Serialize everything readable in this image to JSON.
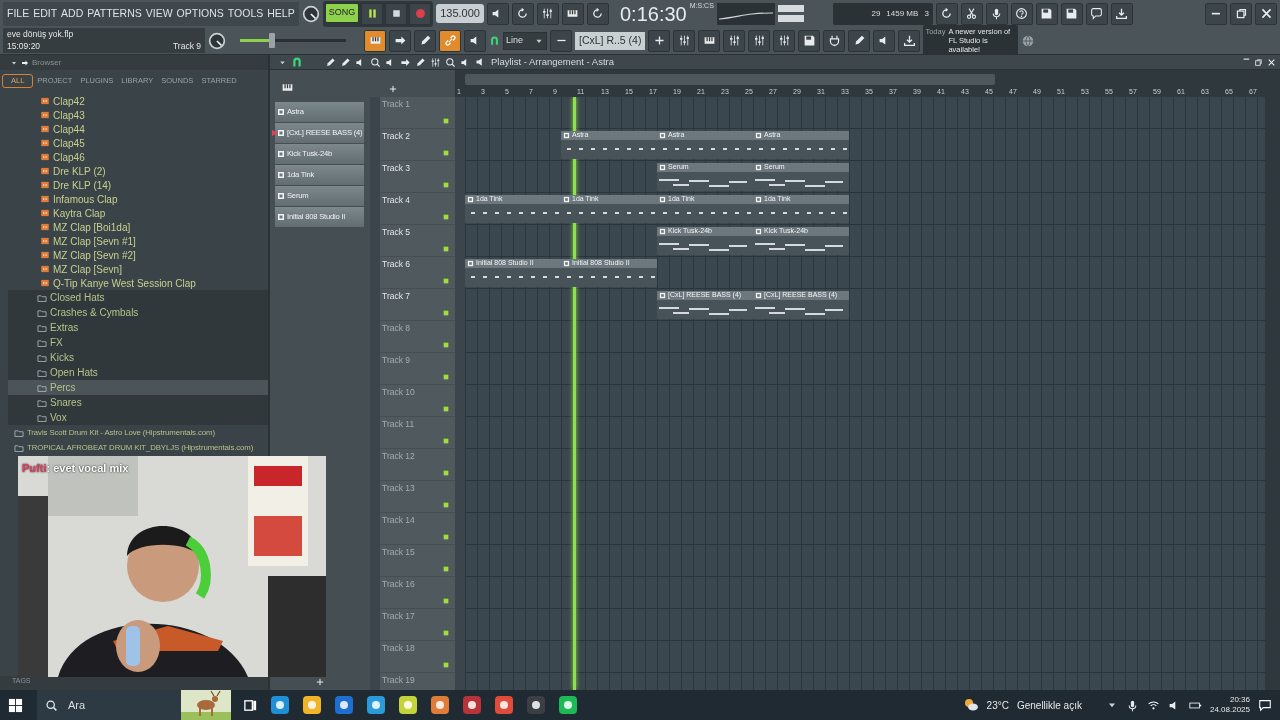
{
  "menu": [
    "FILE",
    "EDIT",
    "ADD",
    "PATTERNS",
    "VIEW",
    "OPTIONS",
    "TOOLS",
    "HELP"
  ],
  "transport": {
    "mode": {
      "label": "SONG",
      "on": true
    },
    "tempo": "135.000",
    "time": "0:16:30",
    "time_unit": "M:S:CS"
  },
  "monitor": {
    "cpu": "29",
    "memory": "1459 MB",
    "polyphony": "3"
  },
  "project": {
    "file": "eve dönüş yok.flp",
    "time": "15:09:20",
    "hint": "Track 9"
  },
  "master_volume": {
    "level": 0.3
  },
  "snap": "Line",
  "pattern": "[CxL] R..5 (4)",
  "news": {
    "label": "Today",
    "text": "A newer version of FL Studio is available!"
  },
  "browser": {
    "title": "Browser",
    "tabs": [
      {
        "label": "ALL",
        "selected": true
      },
      {
        "label": "PROJECT",
        "selected": false
      },
      {
        "label": "PLUGINS",
        "selected": false
      },
      {
        "label": "LIBRARY",
        "selected": false
      },
      {
        "label": "SOUNDS",
        "selected": false
      },
      {
        "label": "STARRED",
        "selected": false
      }
    ],
    "items": [
      {
        "kind": "file",
        "label": "Clap42",
        "selected": false
      },
      {
        "kind": "file",
        "label": "Clap43",
        "selected": false
      },
      {
        "kind": "file",
        "label": "Clap44",
        "selected": false
      },
      {
        "kind": "file",
        "label": "Clap45",
        "selected": false
      },
      {
        "kind": "file",
        "label": "Clap46",
        "selected": false
      },
      {
        "kind": "file",
        "label": "Dre KLP (2)",
        "selected": false
      },
      {
        "kind": "file",
        "label": "Dre KLP (14)",
        "selected": false
      },
      {
        "kind": "file",
        "label": "Infamous Clap",
        "selected": false
      },
      {
        "kind": "file",
        "label": "Kaytra Clap",
        "selected": false
      },
      {
        "kind": "file",
        "label": "MZ Clap [Boi1da]",
        "selected": false
      },
      {
        "kind": "file",
        "label": "MZ Clap [Sevn #1]",
        "selected": false
      },
      {
        "kind": "file",
        "label": "MZ Clap [Sevn #2]",
        "selected": false
      },
      {
        "kind": "file",
        "label": "MZ Clap [Sevn]",
        "selected": false
      },
      {
        "kind": "file",
        "label": "Q-Tip Kanye West Session Clap",
        "selected": false
      },
      {
        "kind": "folder",
        "label": "Closed Hats",
        "selected": false
      },
      {
        "kind": "folder",
        "label": "Crashes & Cymbals",
        "selected": false
      },
      {
        "kind": "folder",
        "label": "Extras",
        "selected": false
      },
      {
        "kind": "folder",
        "label": "FX",
        "selected": false
      },
      {
        "kind": "folder",
        "label": "Kicks",
        "selected": false
      },
      {
        "kind": "folder",
        "label": "Open Hats",
        "selected": false
      },
      {
        "kind": "folder",
        "label": "Percs",
        "selected": true
      },
      {
        "kind": "folder",
        "label": "Snares",
        "selected": false
      },
      {
        "kind": "folder",
        "label": "Vox",
        "selected": false
      },
      {
        "kind": "kit",
        "label": "Travis Scott Drum Kit - Astro Love (Hipstrumentals.com)",
        "selected": false
      },
      {
        "kind": "kit",
        "label": "TROPICAL AFROBEAT DRUM KIT_DBYLJS (Hipstrumentals.com)",
        "selected": false
      }
    ],
    "footer": "TAGS"
  },
  "chat": {
    "user": "Pufti",
    "message": ": evet vocal mix"
  },
  "patterns": [
    {
      "label": "Astra",
      "current": false
    },
    {
      "label": "[CxL] REESE BASS (4)",
      "current": true
    },
    {
      "label": "Kick Tusk-24b",
      "current": false
    },
    {
      "label": "1da Tink",
      "current": false
    },
    {
      "label": "Serum",
      "current": false
    },
    {
      "label": "Initial 808 Studio II",
      "current": false
    }
  ],
  "playlist": {
    "title": "Playlist - Arrangement - Astra",
    "ruler": [
      "1",
      "3",
      "5",
      "7",
      "9",
      "11",
      "13",
      "15",
      "17",
      "19",
      "21",
      "23",
      "25",
      "27",
      "29",
      "31",
      "33",
      "35",
      "37",
      "39",
      "41",
      "43",
      "45",
      "47",
      "49",
      "51",
      "53",
      "55",
      "57",
      "59",
      "61",
      "63",
      "65",
      "67"
    ],
    "tracks": [
      {
        "name": "Track 1"
      },
      {
        "name": "Track 2",
        "clips": [
          {
            "kind": "empty"
          },
          {
            "kind": "pattern",
            "label": "Astra"
          },
          {
            "kind": "pattern",
            "label": "Astra"
          },
          {
            "kind": "pattern",
            "label": "Astra"
          }
        ]
      },
      {
        "name": "Track 3",
        "clips": [
          {
            "kind": "empty"
          },
          {
            "kind": "empty"
          },
          {
            "kind": "pattern",
            "label": "Serum"
          },
          {
            "kind": "pattern",
            "label": "Serum"
          }
        ]
      },
      {
        "name": "Track 4",
        "clips": [
          {
            "kind": "pattern",
            "label": "1da Tink"
          },
          {
            "kind": "pattern",
            "label": "1da Tink"
          },
          {
            "kind": "pattern",
            "label": "1da Tink"
          },
          {
            "kind": "pattern",
            "label": "1da Tink"
          }
        ]
      },
      {
        "name": "Track 5",
        "clips": [
          {
            "kind": "empty"
          },
          {
            "kind": "empty"
          },
          {
            "kind": "pattern",
            "label": "Kick Tusk-24b"
          },
          {
            "kind": "pattern",
            "label": "Kick Tusk-24b"
          }
        ]
      },
      {
        "name": "Track 6",
        "clips": [
          {
            "kind": "pattern",
            "label": "Initial 808 Studio II"
          },
          {
            "kind": "pattern",
            "label": "Initial 808 Studio II"
          }
        ]
      },
      {
        "name": "Track 7",
        "clips": [
          {
            "kind": "empty"
          },
          {
            "kind": "empty"
          },
          {
            "kind": "pattern",
            "label": "[CxL] REESE BASS (4)"
          },
          {
            "kind": "pattern",
            "label": "[CxL] REESE BASS (4)"
          }
        ]
      },
      {
        "name": "Track 8"
      },
      {
        "name": "Track 9"
      },
      {
        "name": "Track 10"
      },
      {
        "name": "Track 11"
      },
      {
        "name": "Track 12"
      },
      {
        "name": "Track 13"
      },
      {
        "name": "Track 14"
      },
      {
        "name": "Track 15"
      },
      {
        "name": "Track 16"
      },
      {
        "name": "Track 17"
      },
      {
        "name": "Track 18"
      },
      {
        "name": "Track 19"
      }
    ]
  },
  "taskbar": {
    "search_placeholder": "Ara",
    "temperature": "23°C",
    "weather": "Genellikle açık",
    "time": "20:36",
    "date": "24.08.2025"
  }
}
